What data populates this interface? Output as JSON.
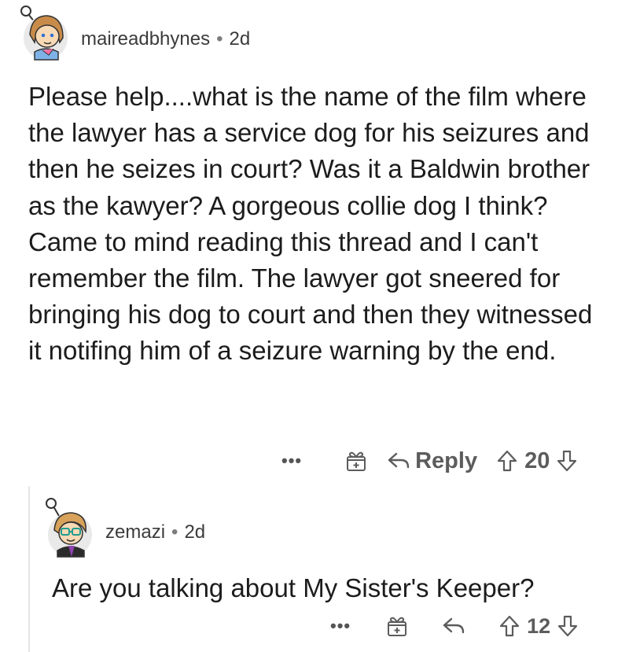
{
  "comments": [
    {
      "username": "maireadbhynes",
      "separator": "•",
      "age": "2d",
      "body": "Please help....what is the name of the film where the lawyer has a service dog for his seizures and then he seizes in court? Was it a Baldwin brother as the kawyer? A gorgeous collie dog I think?  Came to mind reading this thread and I can't remember the film. The lawyer got sneered for bringing his dog to court and then they witnessed it notifing him of a seizure warning by the end.",
      "actions": {
        "more": "•••",
        "reply_label": "Reply",
        "score": "20"
      }
    },
    {
      "username": "zemazi",
      "separator": "•",
      "age": "2d",
      "body": "Are you talking about My Sister's Keeper?",
      "actions": {
        "more": "•••",
        "score": "12"
      }
    }
  ],
  "icons": {
    "avatar_1": "user-avatar-icon",
    "avatar_2": "user-avatar-icon",
    "award": "gift-award-icon",
    "reply": "reply-arrow-icon",
    "upvote": "upvote-arrow-icon",
    "downvote": "downvote-arrow-icon"
  },
  "colors": {
    "text": "#1c1c1c",
    "meta": "#3b3b3b",
    "action": "#5c5c5c",
    "thread_line": "#e5e5e5"
  }
}
